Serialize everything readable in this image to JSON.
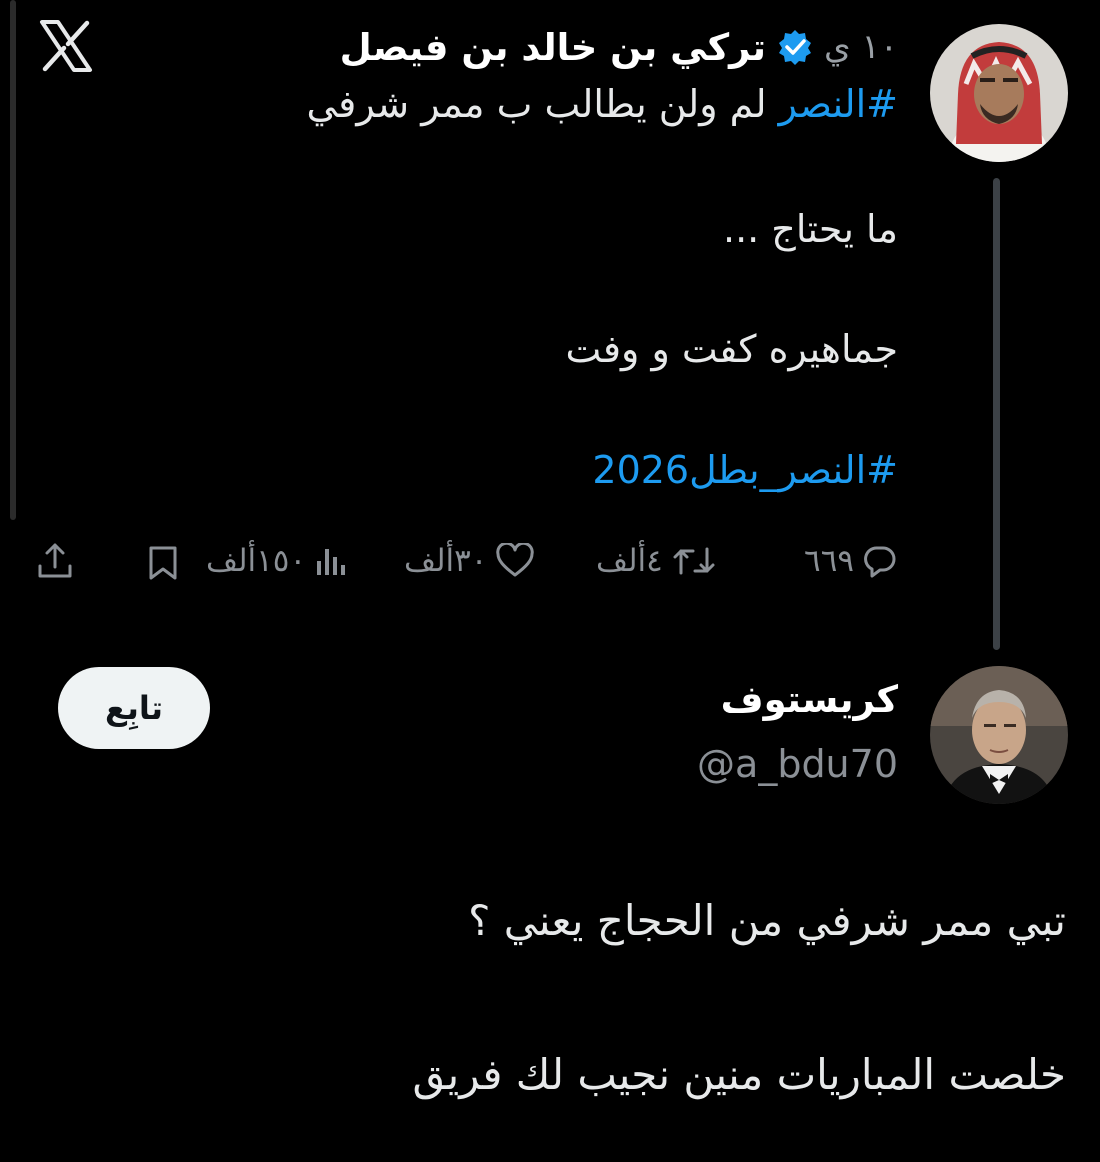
{
  "tweet": {
    "author_name": "تركي بن خالد بن فيصل",
    "verified_icon": "verified-badge-icon",
    "verified_color": "#1d9bf0",
    "time": "١٠ ي",
    "line1_hashtag": "#النصر",
    "line1_rest": " لم ولن يطالب ب ممر شرفي",
    "line2": "ما يحتاج ...",
    "line3": "جماهيره كفت و وفت",
    "line4_hashtag": "#النصر_بطل2026",
    "stats": {
      "replies": "٦٦٩",
      "retweets": "٤ألف",
      "likes": "٣٠ألف",
      "views": "١٥٠ألف"
    }
  },
  "reply": {
    "author_name": "كريستوف",
    "handle": "@a_bdu70",
    "follow_label": "تابِع",
    "line1": "تبي ممر شرفي من الحجاج يعني ؟",
    "line2": "خلصت المباريات منين نجيب لك فريق"
  },
  "colors": {
    "background": "#000000",
    "text": "#e7e9ea",
    "muted": "#8b9096",
    "link": "#1d9bf0"
  }
}
